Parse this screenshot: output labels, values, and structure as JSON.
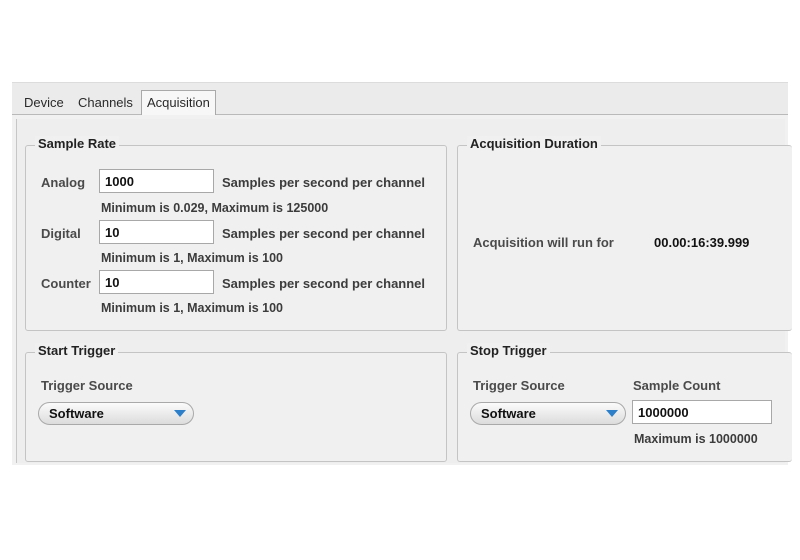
{
  "tabs": [
    {
      "label": "Device"
    },
    {
      "label": "Channels"
    },
    {
      "label": "Acquisition"
    }
  ],
  "sample_rate": {
    "title": "Sample Rate",
    "unit": "Samples per second per channel",
    "analog": {
      "label": "Analog",
      "value": "1000",
      "range": "Minimum is 0.029, Maximum is 125000"
    },
    "digital": {
      "label": "Digital",
      "value": "10",
      "range": "Minimum is 1, Maximum is 100"
    },
    "counter": {
      "label": "Counter",
      "value": "10",
      "range": "Minimum is 1, Maximum is 100"
    }
  },
  "duration": {
    "title": "Acquisition Duration",
    "label": "Acquisition will run for",
    "value": "00.00:16:39.999"
  },
  "start_trigger": {
    "title": "Start Trigger",
    "source_label": "Trigger Source",
    "source_value": "Software"
  },
  "stop_trigger": {
    "title": "Stop Trigger",
    "source_label": "Trigger Source",
    "source_value": "Software",
    "count_label": "Sample Count",
    "count_value": "1000000",
    "count_max": "Maximum is  1000000"
  },
  "colors": {
    "dropdown_arrow": "#2e7fc9",
    "panel_bg": "#f0f0f0"
  }
}
